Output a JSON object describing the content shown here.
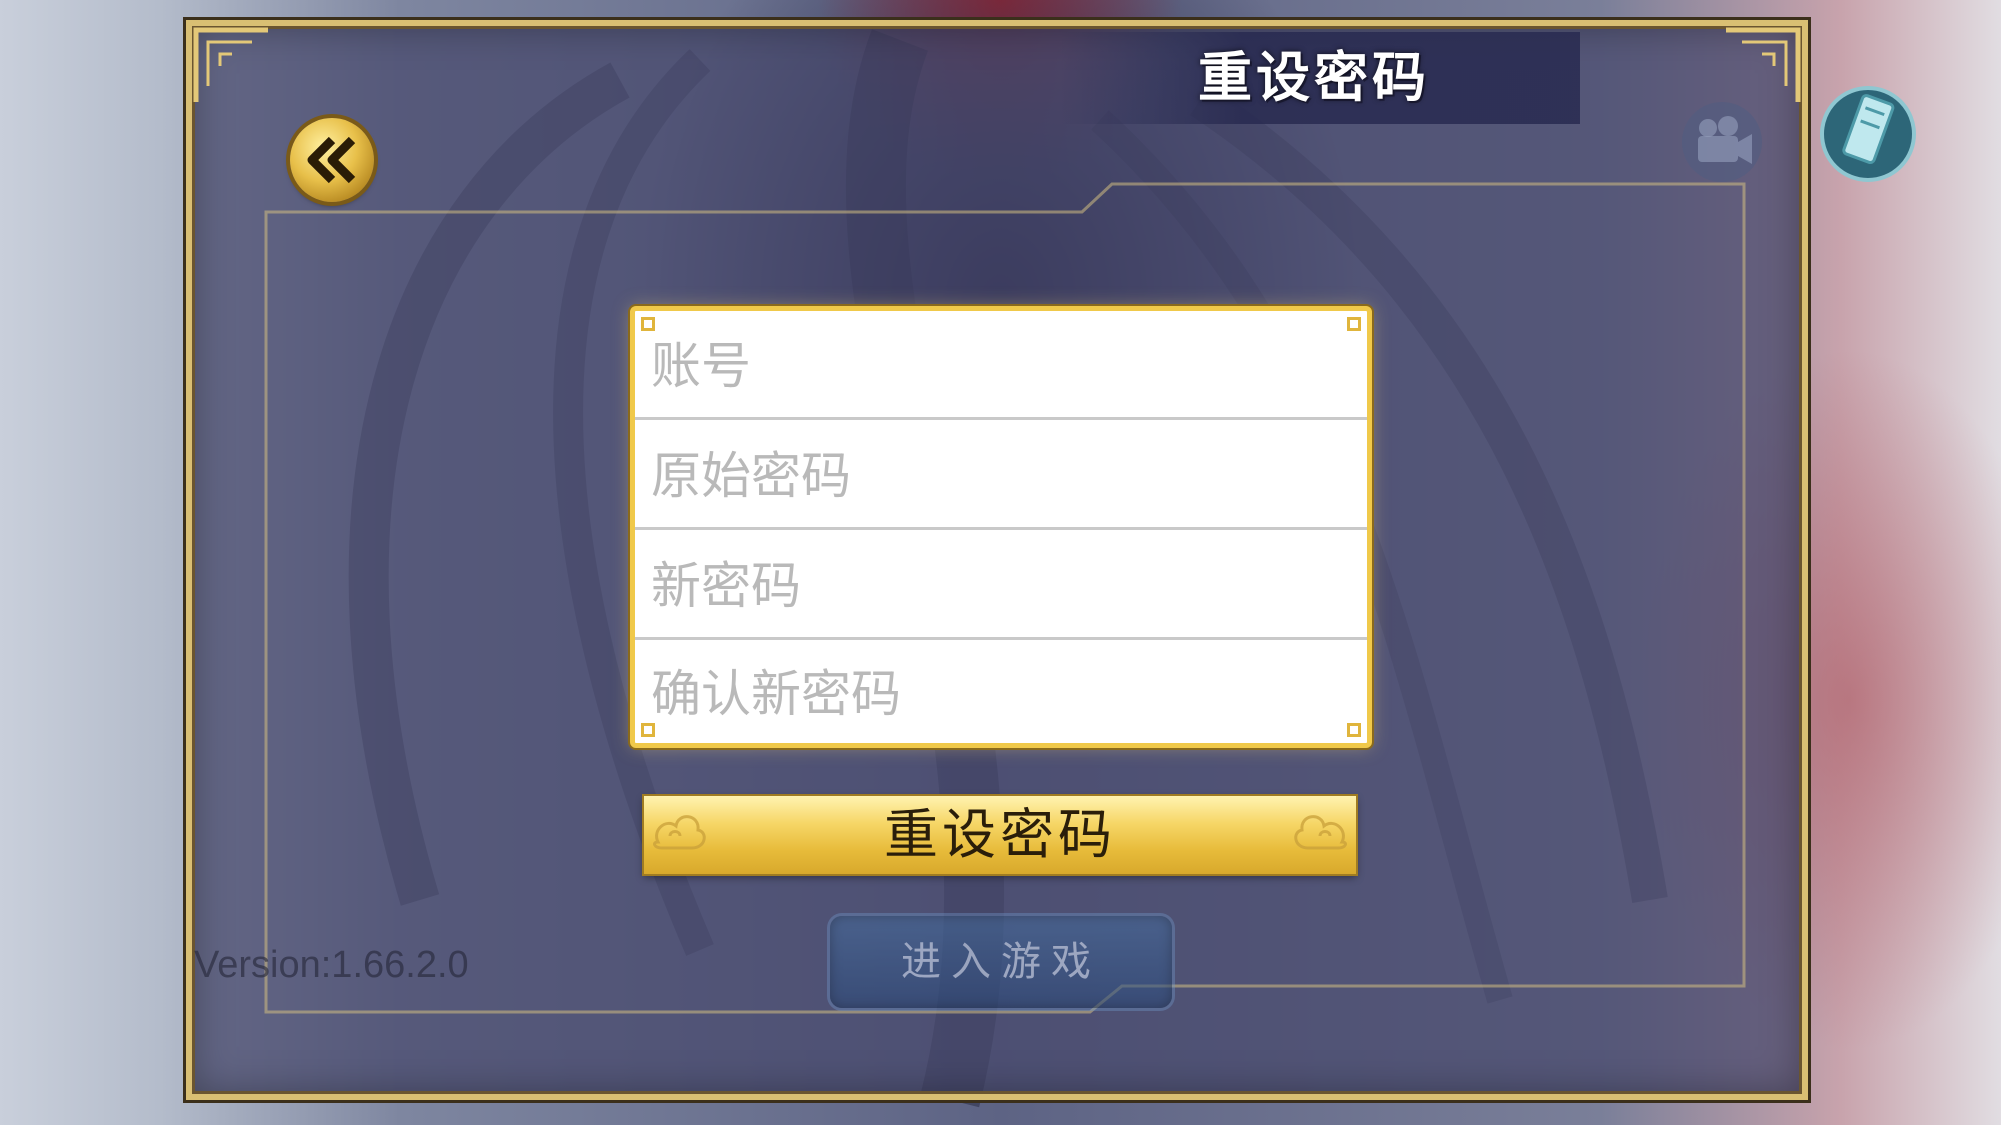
{
  "title": "重设密码",
  "form": {
    "account_placeholder": "账号",
    "old_password_placeholder": "原始密码",
    "new_password_placeholder": "新密码",
    "confirm_password_placeholder": "确认新密码"
  },
  "reset_button_label": "重设密码",
  "enter_game_label": "进入游戏",
  "version_text": "Version:1.66.2.0",
  "icons": {
    "back": "double-chevron-left-icon",
    "skin": "scroll-icon",
    "camera": "video-camera-icon"
  },
  "colors": {
    "gold": "#f0c94a",
    "panel": "#46486c",
    "button_blue": "#3e6aa0"
  }
}
